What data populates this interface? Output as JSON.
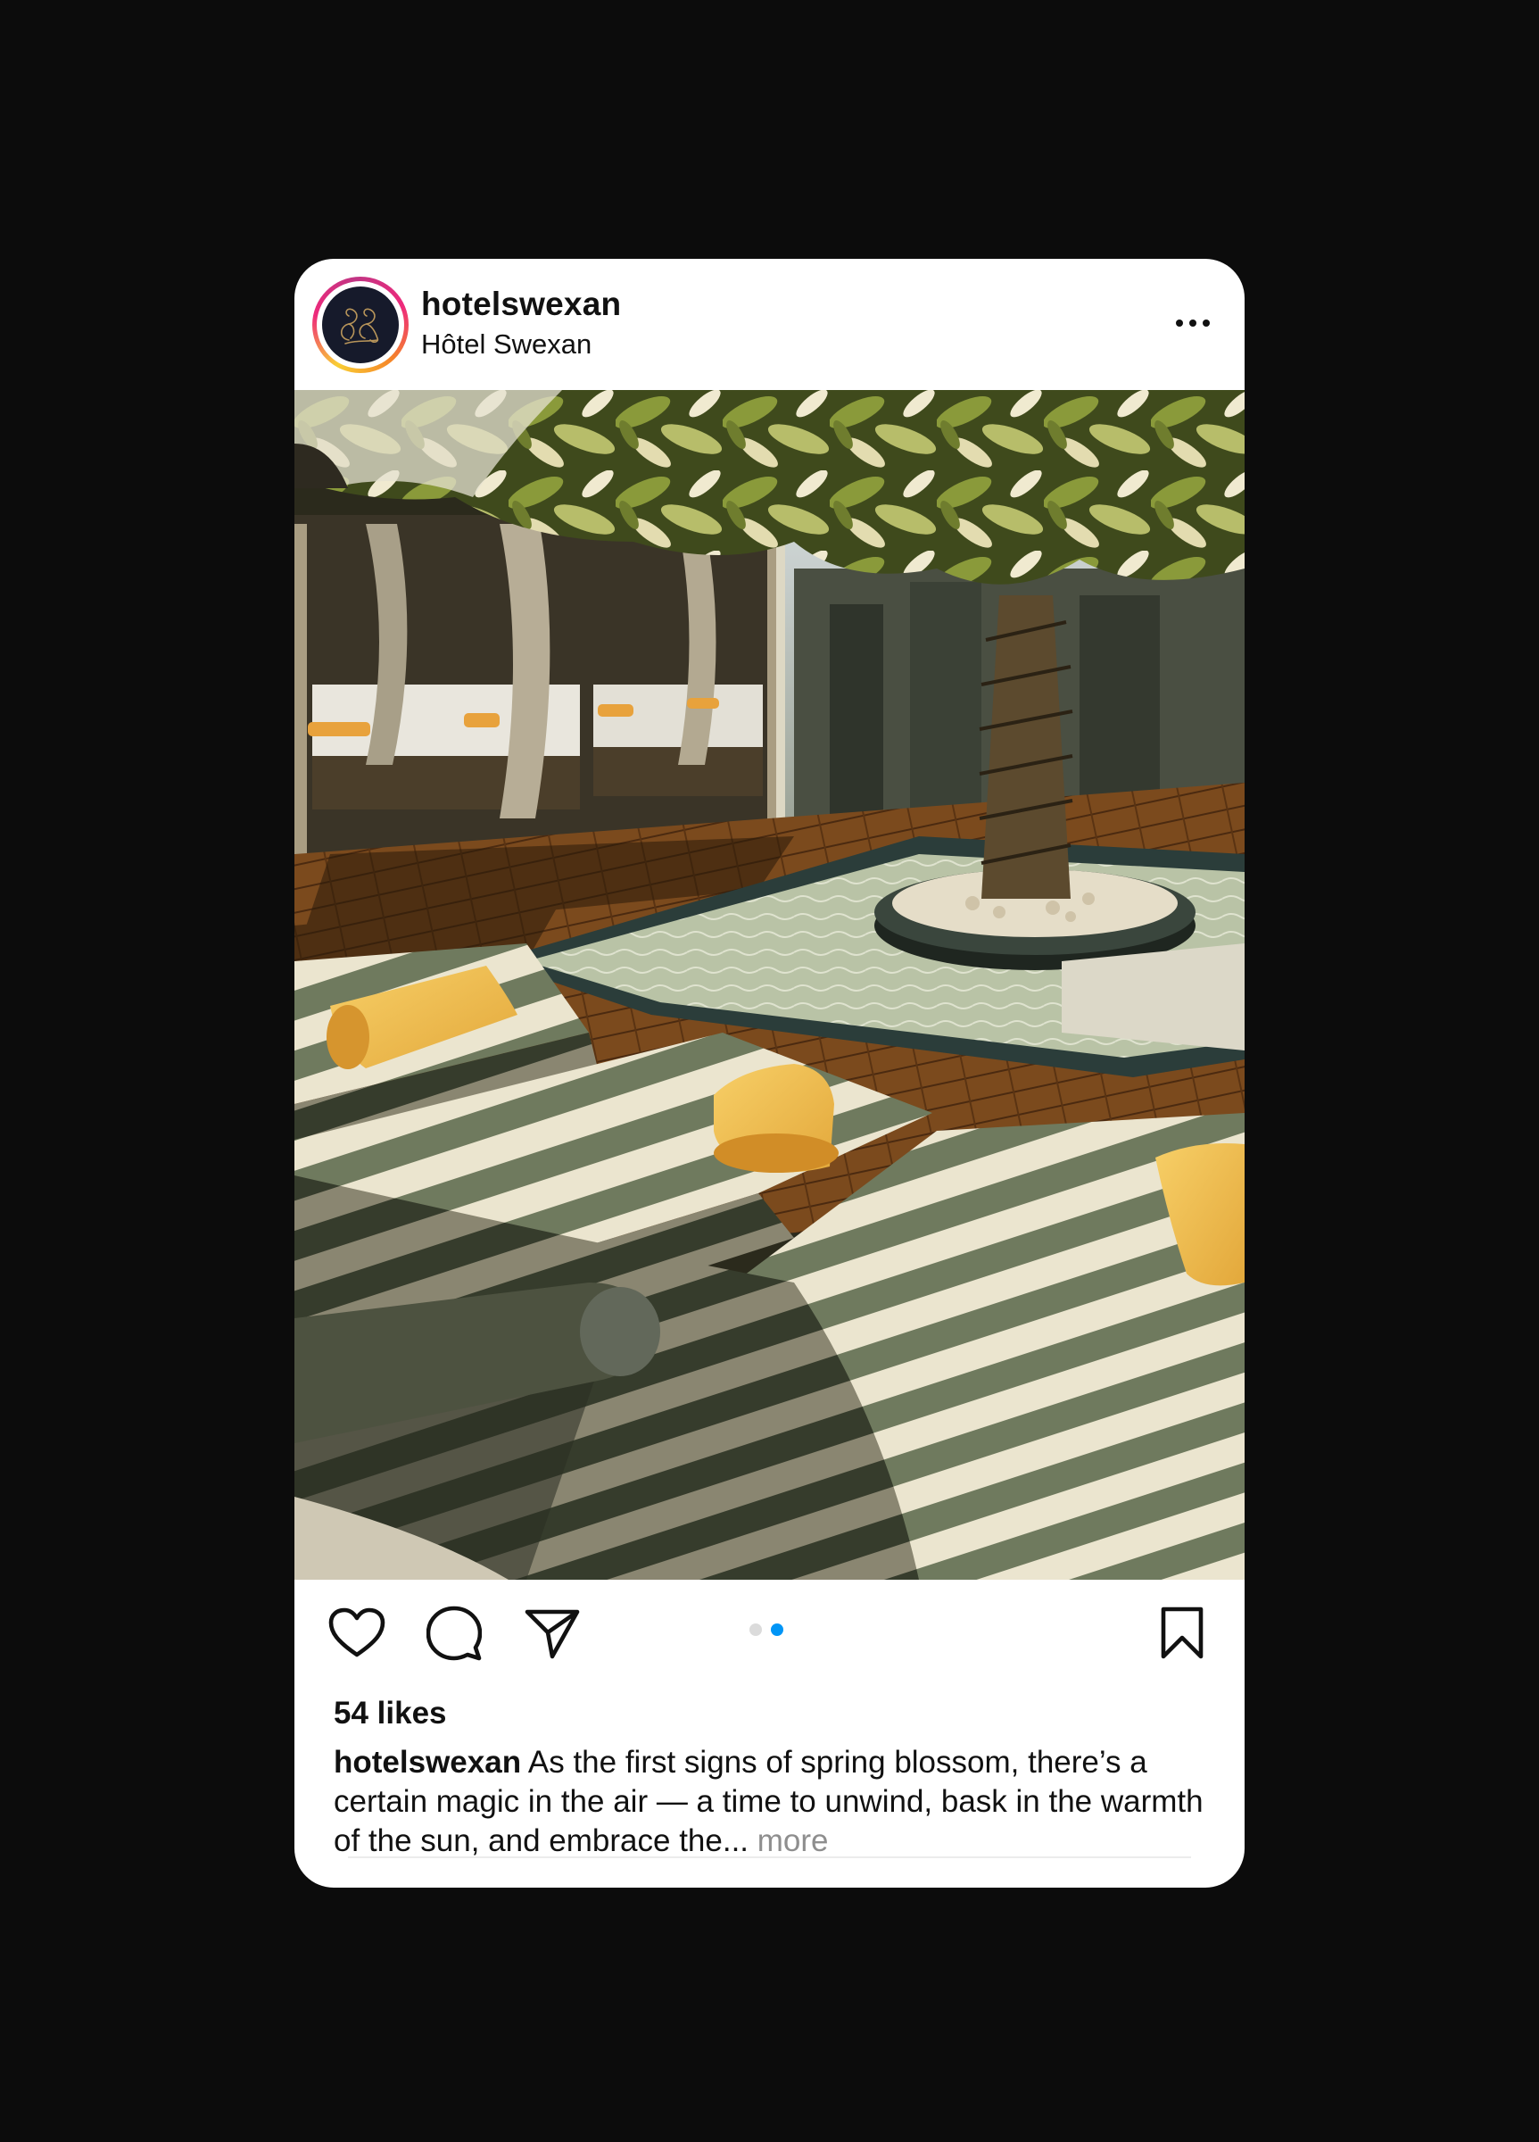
{
  "post": {
    "username": "hotelswexan",
    "location": "Hôtel Swexan",
    "likes": "54 likes",
    "caption_user": "hotelswexan",
    "caption_text": " As the first signs of spring blossom, there’s a certain magic in the air — a time to unwind, bask in the warmth of the sun, and embrace the...",
    "caption_more": " more"
  },
  "carousel": {
    "count": 2,
    "active_index": 1,
    "active_color": "#0095f6",
    "inactive_color": "#dbdbdb"
  },
  "icons": {
    "more": "more-horizontal-icon",
    "like": "heart-icon",
    "comment": "comment-icon",
    "share": "send-icon",
    "save": "bookmark-icon"
  },
  "colors": {
    "page_background": "#0c0c0c",
    "card_background": "#ffffff",
    "avatar_background": "#161a2b",
    "avatar_monogram": "#b8955a"
  }
}
